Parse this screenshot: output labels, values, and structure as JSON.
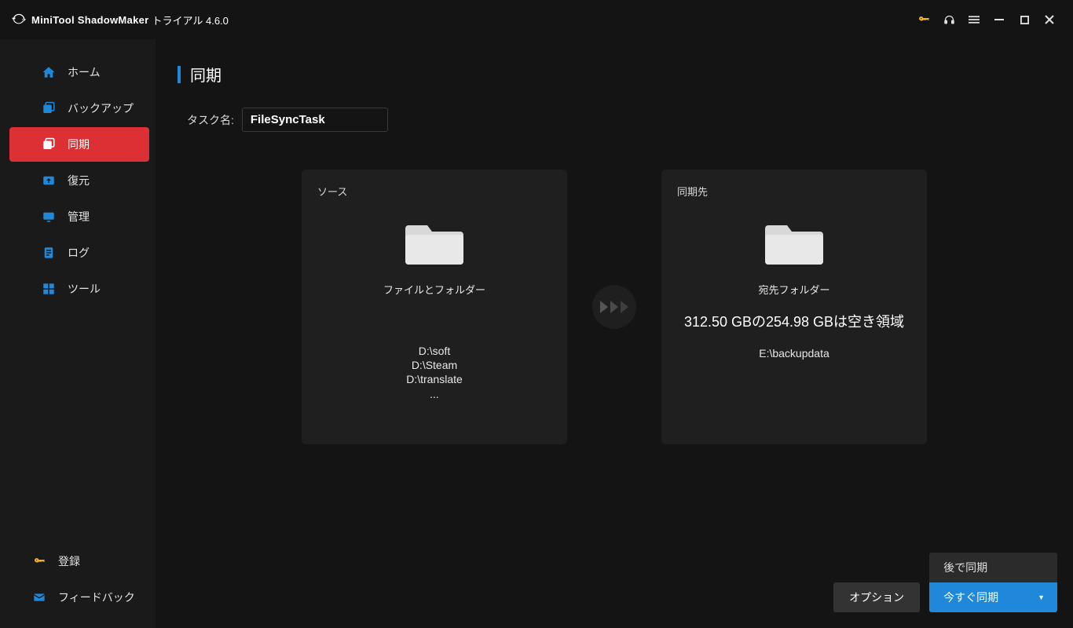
{
  "title": {
    "product": "MiniTool ShadowMaker",
    "suffix": "トライアル 4.6.0"
  },
  "sidebar": {
    "items": [
      {
        "label": "ホーム"
      },
      {
        "label": "バックアップ"
      },
      {
        "label": "同期"
      },
      {
        "label": "復元"
      },
      {
        "label": "管理"
      },
      {
        "label": "ログ"
      },
      {
        "label": "ツール"
      }
    ],
    "register": "登録",
    "feedback": "フィードバック"
  },
  "page": {
    "heading": "同期",
    "task_label": "タスク名:",
    "task_value": "FileSyncTask"
  },
  "source": {
    "title": "ソース",
    "subtitle": "ファイルとフォルダー",
    "paths": [
      "D:\\soft",
      "D:\\Steam",
      "D:\\translate",
      "..."
    ]
  },
  "dest": {
    "title": "同期先",
    "subtitle": "宛先フォルダー",
    "freeinfo": "312.50 GBの254.98 GBは空き領域",
    "path": "E:\\backupdata"
  },
  "buttons": {
    "options": "オプション",
    "later": "後で同期",
    "now": "今すぐ同期"
  }
}
